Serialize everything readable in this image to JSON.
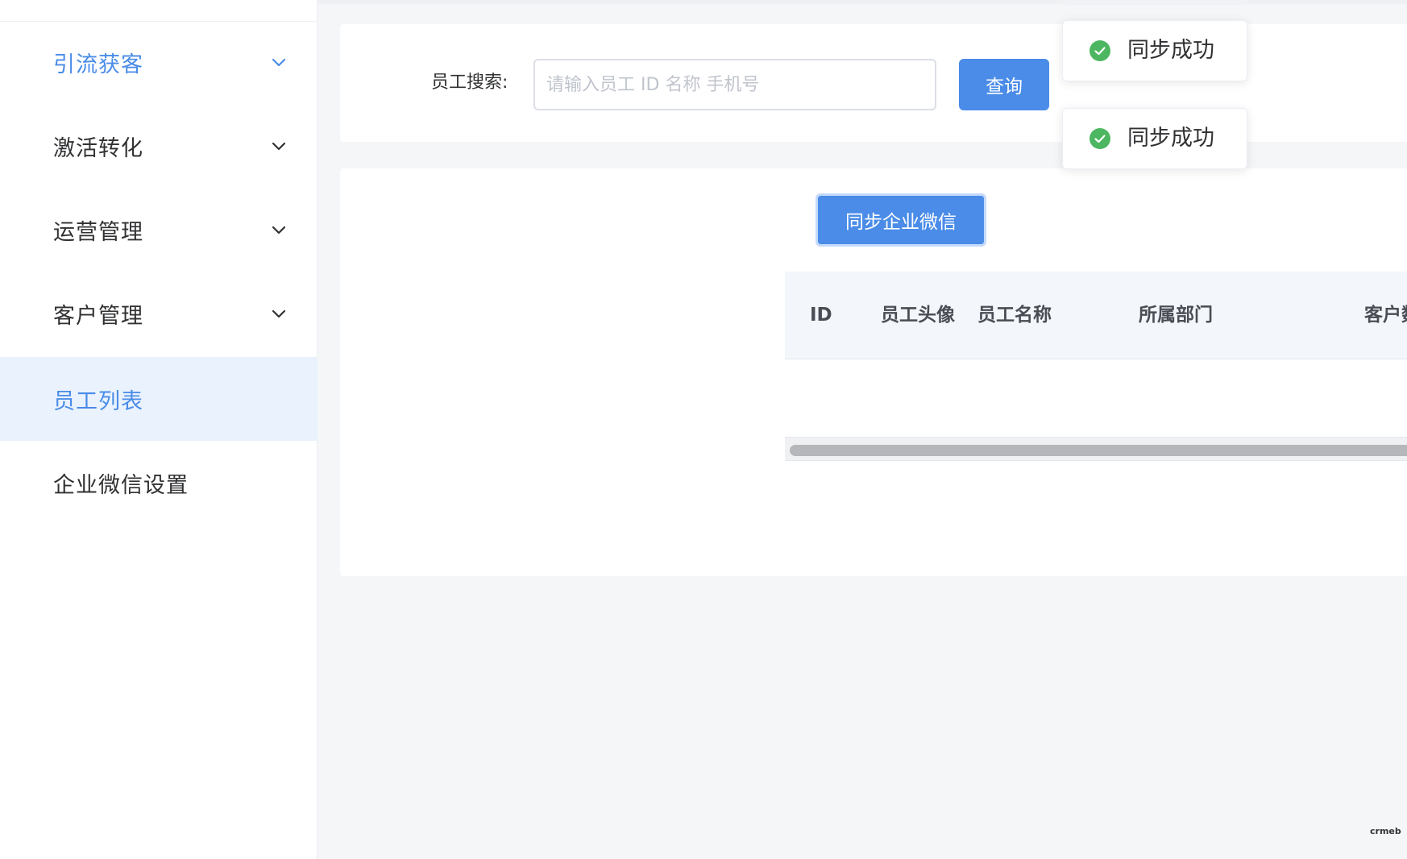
{
  "sidebar": {
    "items": [
      {
        "label": "引流获客",
        "state": "open",
        "has_submenu": true
      },
      {
        "label": "激活转化",
        "state": "collapsed",
        "has_submenu": true
      },
      {
        "label": "运营管理",
        "state": "collapsed",
        "has_submenu": true
      },
      {
        "label": "客户管理",
        "state": "collapsed",
        "has_submenu": true
      },
      {
        "label": "员工列表",
        "state": "active",
        "has_submenu": false
      },
      {
        "label": "企业微信设置",
        "state": "normal",
        "has_submenu": false
      }
    ]
  },
  "search": {
    "label": "员工搜索:",
    "placeholder": "请输入员工 ID 名称 手机号",
    "value": "",
    "button_label": "查询"
  },
  "toolbar": {
    "sync_label": "同步企业微信"
  },
  "table": {
    "columns": [
      "ID",
      "员工头像",
      "员工名称",
      "所属部门",
      "客户数"
    ],
    "rows": []
  },
  "toasts": [
    {
      "type": "success",
      "icon": "check-circle-icon",
      "message": "同步成功"
    },
    {
      "type": "success",
      "icon": "check-circle-icon",
      "message": "同步成功"
    }
  ],
  "watermark": "crmeb",
  "colors": {
    "accent": "#4a8ce8",
    "active_bg": "#eaf2fd",
    "success": "#4cb760",
    "text": "#303133"
  }
}
